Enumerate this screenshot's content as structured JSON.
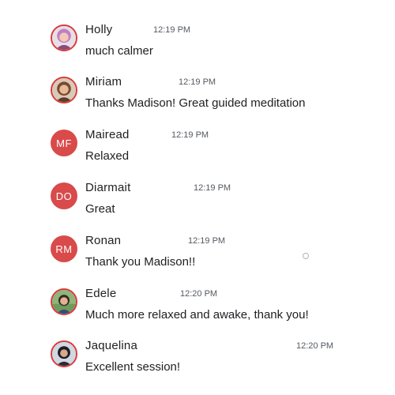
{
  "colors": {
    "avatar_initials_bg": "#d94a4a",
    "avatar_ring": "#d93b3b",
    "text": "#202124",
    "timestamp": "#555a60"
  },
  "messages": [
    {
      "name": "Holly",
      "time": "12:19 PM",
      "text": "much calmer",
      "avatar": {
        "type": "photo",
        "icon": "holly-avatar-photo"
      }
    },
    {
      "name": "Miriam",
      "time": "12:19 PM",
      "text": "Thanks Madison! Great guided meditation",
      "avatar": {
        "type": "photo",
        "icon": "miriam-avatar-photo"
      }
    },
    {
      "name": "Mairead",
      "time": "12:19 PM",
      "text": "Relaxed",
      "avatar": {
        "type": "initials",
        "initials": "MF"
      }
    },
    {
      "name": "Diarmait",
      "time": "12:19 PM",
      "text": "Great",
      "avatar": {
        "type": "initials",
        "initials": "DO"
      }
    },
    {
      "name": "Ronan",
      "time": "12:19 PM",
      "text": "Thank you Madison!!",
      "avatar": {
        "type": "initials",
        "initials": "RM"
      }
    },
    {
      "name": "Edele",
      "time": "12:20 PM",
      "text": "Much more relaxed and awake, thank you!",
      "avatar": {
        "type": "photo",
        "icon": "edele-avatar-photo"
      }
    },
    {
      "name": "Jaquelina",
      "time": "12:20 PM",
      "text": "Excellent session!",
      "avatar": {
        "type": "photo",
        "icon": "jaquelina-avatar-photo"
      }
    }
  ]
}
